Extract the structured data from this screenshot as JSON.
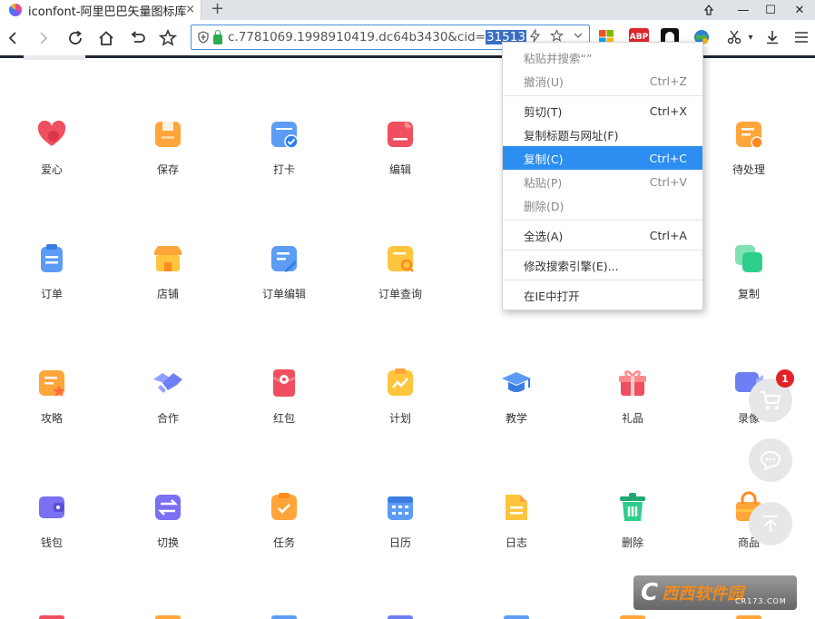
{
  "tab": {
    "title": "iconfont-阿里巴巴矢量图标库",
    "close": "×",
    "new_tab": "+"
  },
  "window": {
    "minimize": "—",
    "maximize": "☐",
    "close": "✕"
  },
  "toolbar": {
    "url_text": "c.7781069.1998910419.dc64b3430&cid=",
    "url_selected": "31513",
    "ext_abp": "ABP"
  },
  "icons": [
    {
      "label": "爱心",
      "icon": "heart-icon",
      "color": "#ef4f5f"
    },
    {
      "label": "保存",
      "icon": "save-icon",
      "color": "#ffa53a"
    },
    {
      "label": "打卡",
      "icon": "check-in-icon",
      "color": "#5c9cf5"
    },
    {
      "label": "编辑",
      "icon": "edit-icon",
      "color": "#ef4f5f"
    },
    {
      "label": "待处理",
      "icon": "pending-icon",
      "color": "#ffa53a"
    },
    {
      "label": "订单",
      "icon": "order-icon",
      "color": "#5c9cf5"
    },
    {
      "label": "店铺",
      "icon": "shop-icon",
      "color": "#ffa53a"
    },
    {
      "label": "订单编辑",
      "icon": "order-edit-icon",
      "color": "#5c9cf5"
    },
    {
      "label": "订单查询",
      "icon": "order-search-icon",
      "color": "#ffc53d"
    },
    {
      "label": "复制",
      "icon": "copy-icon",
      "color": "#2fce8a"
    },
    {
      "label": "攻略",
      "icon": "guide-icon",
      "color": "#ffa53a"
    },
    {
      "label": "合作",
      "icon": "cooperation-icon",
      "color": "#6e7ff3"
    },
    {
      "label": "红包",
      "icon": "red-packet-icon",
      "color": "#ef4f5f"
    },
    {
      "label": "计划",
      "icon": "plan-icon",
      "color": "#ffc53d"
    },
    {
      "label": "教学",
      "icon": "teaching-icon",
      "color": "#5c9cf5"
    },
    {
      "label": "礼品",
      "icon": "gift-icon",
      "color": "#ef4f5f"
    },
    {
      "label": "录像",
      "icon": "video-icon",
      "color": "#6e7ff3"
    },
    {
      "label": "钱包",
      "icon": "wallet-icon",
      "color": "#7b6ff3"
    },
    {
      "label": "切换",
      "icon": "switch-icon",
      "color": "#7b6ff3"
    },
    {
      "label": "任务",
      "icon": "task-icon",
      "color": "#ffa53a"
    },
    {
      "label": "日历",
      "icon": "calendar-icon",
      "color": "#5c9cf5"
    },
    {
      "label": "日志",
      "icon": "log-icon",
      "color": "#ffc53d"
    },
    {
      "label": "删除",
      "icon": "delete-icon",
      "color": "#2fce8a"
    },
    {
      "label": "商品",
      "icon": "goods-icon",
      "color": "#ffa53a"
    }
  ],
  "context_menu": [
    {
      "label": "粘贴并搜索“”",
      "shortcut": "",
      "state": "disabled"
    },
    {
      "label": "撤消(U)",
      "shortcut": "Ctrl+Z",
      "state": "disabled"
    },
    {
      "sep": true
    },
    {
      "label": "剪切(T)",
      "shortcut": "Ctrl+X",
      "state": "normal"
    },
    {
      "label": "复制标题与网址(F)",
      "shortcut": "",
      "state": "normal"
    },
    {
      "label": "复制(C)",
      "shortcut": "Ctrl+C",
      "state": "highlighted"
    },
    {
      "label": "粘贴(P)",
      "shortcut": "Ctrl+V",
      "state": "disabled"
    },
    {
      "label": "删除(D)",
      "shortcut": "",
      "state": "disabled"
    },
    {
      "sep": true
    },
    {
      "label": "全选(A)",
      "shortcut": "Ctrl+A",
      "state": "normal"
    },
    {
      "sep": true
    },
    {
      "label": "修改搜索引擎(E)...",
      "shortcut": "",
      "state": "normal"
    },
    {
      "sep": true
    },
    {
      "label": "在IE中打开",
      "shortcut": "",
      "state": "normal"
    }
  ],
  "cart_badge": "1",
  "watermark": {
    "logo": "C",
    "main": "西西软件园",
    "sub": "CR173.COM"
  }
}
